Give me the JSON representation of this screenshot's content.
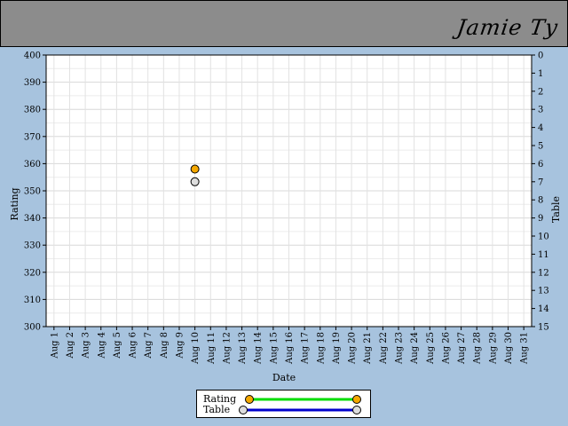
{
  "header": {
    "user_name": "Jamie Ty"
  },
  "chart_data": {
    "type": "scatter",
    "xlabel": "Date",
    "ylabel": "Rating",
    "y2label": "Table",
    "categories": [
      "Aug 1",
      "Aug 2",
      "Aug 3",
      "Aug 4",
      "Aug 5",
      "Aug 6",
      "Aug 7",
      "Aug 8",
      "Aug 9",
      "Aug 10",
      "Aug 11",
      "Aug 12",
      "Aug 13",
      "Aug 14",
      "Aug 15",
      "Aug 16",
      "Aug 17",
      "Aug 18",
      "Aug 19",
      "Aug 20",
      "Aug 21",
      "Aug 22",
      "Aug 23",
      "Aug 24",
      "Aug 25",
      "Aug 26",
      "Aug 27",
      "Aug 28",
      "Aug 29",
      "Aug 30",
      "Aug 31"
    ],
    "ylim": [
      300,
      400
    ],
    "yticks": [
      300,
      310,
      320,
      330,
      340,
      350,
      360,
      370,
      380,
      390,
      400
    ],
    "y2lim": [
      15,
      0
    ],
    "y2ticks": [
      0,
      1,
      2,
      3,
      4,
      5,
      6,
      7,
      8,
      9,
      10,
      11,
      12,
      13,
      14,
      15
    ],
    "grid": true,
    "legend_position": "bottom",
    "series": [
      {
        "name": "Rating",
        "axis": "left",
        "points": [
          {
            "x": "Aug 10",
            "y": 358
          }
        ],
        "marker_color": "#f5a800",
        "line_color": "#00dd00"
      },
      {
        "name": "Table",
        "axis": "right",
        "points": [
          {
            "x": "Aug 10",
            "y": 7
          }
        ],
        "marker_color": "#dddddd",
        "line_color": "#0000cc"
      }
    ]
  }
}
